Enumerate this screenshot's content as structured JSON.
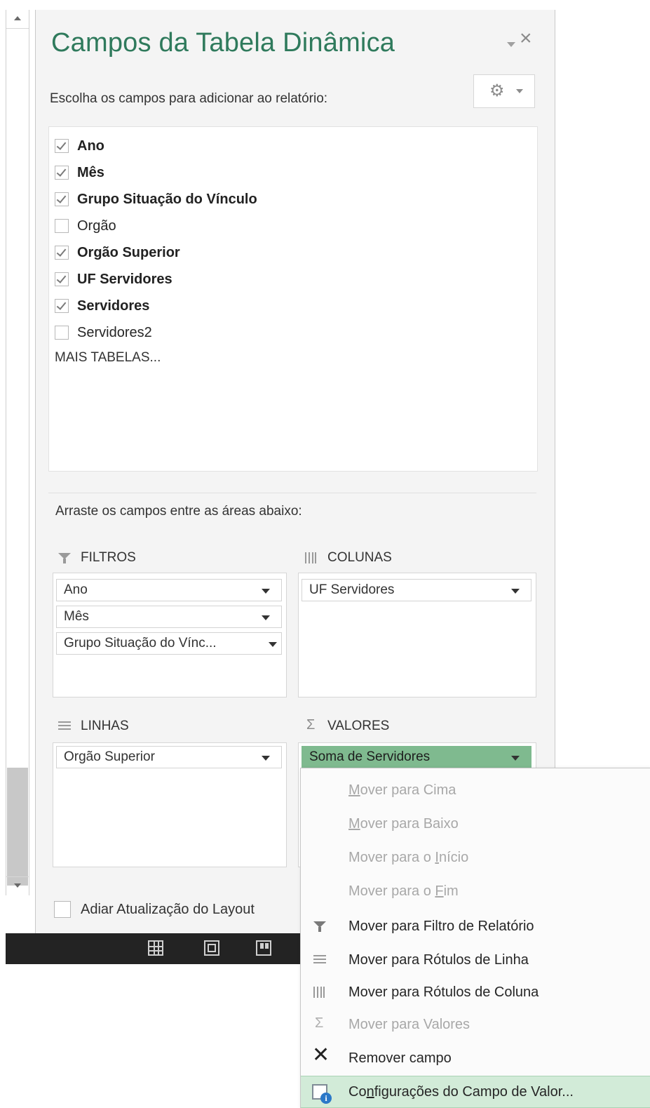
{
  "pane": {
    "title": "Campos da Tabela Dinâmica",
    "close_glyph": "×",
    "choose_label": "Escolha os campos para adicionar ao relatório:",
    "fields": [
      {
        "label": "Ano",
        "checked": true
      },
      {
        "label": "Mês",
        "checked": true
      },
      {
        "label": "Grupo Situação do Vínculo",
        "checked": true
      },
      {
        "label": "Orgão",
        "checked": false
      },
      {
        "label": "Orgão Superior",
        "checked": true
      },
      {
        "label": "UF Servidores",
        "checked": true
      },
      {
        "label": "Servidores",
        "checked": true
      },
      {
        "label": "Servidores2",
        "checked": false
      }
    ],
    "more_tables": "MAIS TABELAS...",
    "drag_label": "Arraste os campos entre as áreas abaixo:",
    "areas": {
      "filters": {
        "title": "FILTROS",
        "items": [
          "Ano",
          "Mês",
          "Grupo Situação do Vínc..."
        ]
      },
      "columns": {
        "title": "COLUNAS",
        "items": [
          "UF Servidores"
        ]
      },
      "rows": {
        "title": "LINHAS",
        "items": [
          "Orgão Superior"
        ]
      },
      "values": {
        "title": "VALORES",
        "items": [
          "Soma de Servidores"
        ]
      }
    },
    "defer_label": "Adiar Atualização do Layout",
    "defer_checked": false
  },
  "menu": {
    "items": [
      {
        "pre": "",
        "u": "M",
        "post": "over para Cima",
        "disabled": true
      },
      {
        "pre": "",
        "u": "M",
        "post": "over para Baixo",
        "disabled": true
      },
      {
        "pre": "Mover para o ",
        "u": "I",
        "post": "nício",
        "disabled": true
      },
      {
        "pre": "Mover para o ",
        "u": "F",
        "post": "im",
        "disabled": true
      },
      {
        "pre": "Mover para Filtro de Relatório",
        "u": "",
        "post": "",
        "disabled": false,
        "icon": "filter-icon"
      },
      {
        "pre": "Mover para Rótulos de Linha",
        "u": "",
        "post": "",
        "disabled": false,
        "icon": "rows-icon"
      },
      {
        "pre": "Mover para Rótulos de Coluna",
        "u": "",
        "post": "",
        "disabled": false,
        "icon": "columns-icon"
      },
      {
        "pre": "Mover para Valores",
        "u": "",
        "post": "",
        "disabled": true,
        "icon": "sigma-icon"
      },
      {
        "pre": "Remover campo",
        "u": "",
        "post": "",
        "disabled": false,
        "icon": "close-icon"
      },
      {
        "pre": "Co",
        "u": "n",
        "post": "figurações do Campo de Valor...",
        "disabled": false,
        "icon": "field-settings-icon",
        "highlight": true
      }
    ]
  },
  "colors": {
    "title_green": "#2f7a5c",
    "active_chip": "#7fba8f",
    "highlight": "#d2ebd8",
    "statusbar": "#232323"
  }
}
